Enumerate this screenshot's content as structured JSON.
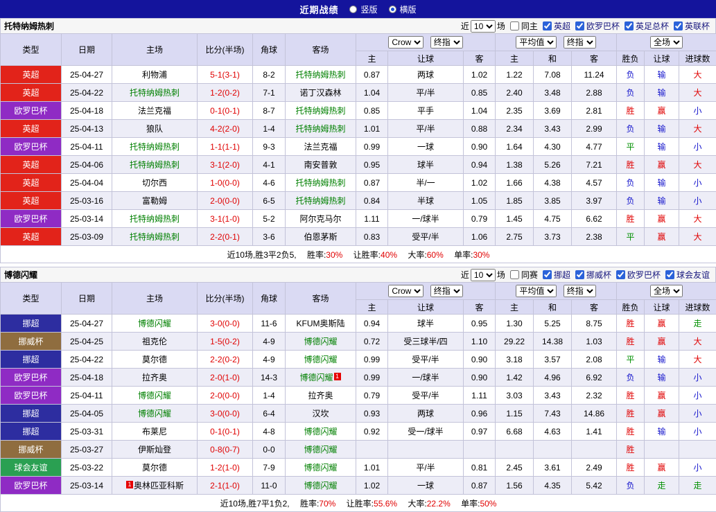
{
  "topbar": {
    "title": "近期战绩",
    "options": [
      {
        "label": "竖版",
        "selected": false
      },
      {
        "label": "横版",
        "selected": true
      }
    ]
  },
  "colors": {
    "topbar_bg": "#14149c",
    "header_bg": "#dadaf3",
    "alt_row_bg": "#ededf7",
    "focus_team_green": "#008000",
    "score_red": "#e00000",
    "result_red": "#e00000",
    "result_blue": "#1515cc",
    "result_green": "#009000",
    "league_colors": {
      "英超": "#e2231a",
      "欧罗巴杯": "#8f2bc4",
      "挪超": "#2d2da0",
      "挪威杯": "#8f6d3f",
      "球会友谊": "#2aa052"
    }
  },
  "sections": [
    {
      "team": "托特纳姆热刺",
      "filter": {
        "near": "近",
        "count": "10",
        "unit": "场",
        "same_label": "同主",
        "leagues": [
          "英超",
          "欧罗巴杯",
          "英足总杯",
          "英联杯"
        ]
      },
      "selects": {
        "book": "Crow",
        "fin1": "终指",
        "avg": "平均值",
        "fin2": "终指",
        "scope": "全场"
      },
      "columns": {
        "c1": "类型",
        "c2": "日期",
        "c3": "主场",
        "c4": "比分(半场)",
        "c5": "角球",
        "c6": "客场",
        "sub": [
          "主",
          "让球",
          "客",
          "主",
          "和",
          "客",
          "胜负",
          "让球",
          "进球数"
        ]
      },
      "rows": [
        {
          "lg": "英超",
          "date": "25-04-27",
          "home": "利物浦",
          "ht": 0,
          "hrc": "",
          "score": "5-1(3-1)",
          "cn": "8-2",
          "away": "托特纳姆热刺",
          "at": 1,
          "arc": "",
          "o1": "0.87",
          "line": "两球",
          "o2": "1.02",
          "e1": "1.22",
          "e2": "7.08",
          "e3": "11.24",
          "r1": "负",
          "r2": "输",
          "r3": "大"
        },
        {
          "lg": "英超",
          "date": "25-04-22",
          "home": "托特纳姆热刺",
          "ht": 1,
          "hrc": "",
          "score": "1-2(0-2)",
          "cn": "7-1",
          "away": "诺丁汉森林",
          "at": 0,
          "arc": "",
          "o1": "1.04",
          "line": "平/半",
          "o2": "0.85",
          "e1": "2.40",
          "e2": "3.48",
          "e3": "2.88",
          "r1": "负",
          "r2": "输",
          "r3": "大"
        },
        {
          "lg": "欧罗巴杯",
          "date": "25-04-18",
          "home": "法兰克福",
          "ht": 0,
          "hrc": "",
          "score": "0-1(0-1)",
          "cn": "8-7",
          "away": "托特纳姆热刺",
          "at": 1,
          "arc": "",
          "o1": "0.85",
          "line": "平手",
          "o2": "1.04",
          "e1": "2.35",
          "e2": "3.69",
          "e3": "2.81",
          "r1": "胜",
          "r2": "赢",
          "r3": "小"
        },
        {
          "lg": "英超",
          "date": "25-04-13",
          "home": "狼队",
          "ht": 0,
          "hrc": "",
          "score": "4-2(2-0)",
          "cn": "1-4",
          "away": "托特纳姆热刺",
          "at": 1,
          "arc": "",
          "o1": "1.01",
          "line": "平/半",
          "o2": "0.88",
          "e1": "2.34",
          "e2": "3.43",
          "e3": "2.99",
          "r1": "负",
          "r2": "输",
          "r3": "大"
        },
        {
          "lg": "欧罗巴杯",
          "date": "25-04-11",
          "home": "托特纳姆热刺",
          "ht": 1,
          "hrc": "",
          "score": "1-1(1-1)",
          "cn": "9-3",
          "away": "法兰克福",
          "at": 0,
          "arc": "",
          "o1": "0.99",
          "line": "一球",
          "o2": "0.90",
          "e1": "1.64",
          "e2": "4.30",
          "e3": "4.77",
          "r1": "平",
          "r2": "输",
          "r3": "小"
        },
        {
          "lg": "英超",
          "date": "25-04-06",
          "home": "托特纳姆热刺",
          "ht": 1,
          "hrc": "",
          "score": "3-1(2-0)",
          "cn": "4-1",
          "away": "南安普敦",
          "at": 0,
          "arc": "",
          "o1": "0.95",
          "line": "球半",
          "o2": "0.94",
          "e1": "1.38",
          "e2": "5.26",
          "e3": "7.21",
          "r1": "胜",
          "r2": "赢",
          "r3": "大"
        },
        {
          "lg": "英超",
          "date": "25-04-04",
          "home": "切尔西",
          "ht": 0,
          "hrc": "",
          "score": "1-0(0-0)",
          "cn": "4-6",
          "away": "托特纳姆热刺",
          "at": 1,
          "arc": "",
          "o1": "0.87",
          "line": "半/一",
          "o2": "1.02",
          "e1": "1.66",
          "e2": "4.38",
          "e3": "4.57",
          "r1": "负",
          "r2": "输",
          "r3": "小"
        },
        {
          "lg": "英超",
          "date": "25-03-16",
          "home": "富勒姆",
          "ht": 0,
          "hrc": "",
          "score": "2-0(0-0)",
          "cn": "6-5",
          "away": "托特纳姆热刺",
          "at": 1,
          "arc": "",
          "o1": "0.84",
          "line": "半球",
          "o2": "1.05",
          "e1": "1.85",
          "e2": "3.85",
          "e3": "3.97",
          "r1": "负",
          "r2": "输",
          "r3": "小"
        },
        {
          "lg": "欧罗巴杯",
          "date": "25-03-14",
          "home": "托特纳姆热刺",
          "ht": 1,
          "hrc": "",
          "score": "3-1(1-0)",
          "cn": "5-2",
          "away": "阿尔克马尔",
          "at": 0,
          "arc": "",
          "o1": "1.11",
          "line": "一/球半",
          "o2": "0.79",
          "e1": "1.45",
          "e2": "4.75",
          "e3": "6.62",
          "r1": "胜",
          "r2": "赢",
          "r3": "大"
        },
        {
          "lg": "英超",
          "date": "25-03-09",
          "home": "托特纳姆热刺",
          "ht": 1,
          "hrc": "",
          "score": "2-2(0-1)",
          "cn": "3-6",
          "away": "伯恩茅斯",
          "at": 0,
          "arc": "",
          "o1": "0.83",
          "line": "受平/半",
          "o2": "1.06",
          "e1": "2.75",
          "e2": "3.73",
          "e3": "2.38",
          "r1": "平",
          "r2": "赢",
          "r3": "大"
        }
      ],
      "summary": {
        "prefix": "近10场,胜3平2负5,",
        "parts": [
          {
            "label": "胜率:",
            "value": "30%"
          },
          {
            "label": "让胜率:",
            "value": "40%"
          },
          {
            "label": "大率:",
            "value": "60%"
          },
          {
            "label": "单率:",
            "value": "30%"
          }
        ]
      }
    },
    {
      "team": "博德闪耀",
      "filter": {
        "near": "近",
        "count": "10",
        "unit": "场",
        "same_label": "同赛",
        "leagues": [
          "挪超",
          "挪威杯",
          "欧罗巴杯",
          "球会友谊"
        ]
      },
      "selects": {
        "book": "Crow",
        "fin1": "终指",
        "avg": "平均值",
        "fin2": "终指",
        "scope": "全场"
      },
      "columns": {
        "c1": "类型",
        "c2": "日期",
        "c3": "主场",
        "c4": "比分(半场)",
        "c5": "角球",
        "c6": "客场",
        "sub": [
          "主",
          "让球",
          "客",
          "主",
          "和",
          "客",
          "胜负",
          "让球",
          "进球数"
        ]
      },
      "rows": [
        {
          "lg": "挪超",
          "date": "25-04-27",
          "home": "博德闪耀",
          "ht": 1,
          "hrc": "",
          "score": "3-0(0-0)",
          "cn": "11-6",
          "away": "KFUM奥斯陆",
          "at": 0,
          "arc": "",
          "o1": "0.94",
          "line": "球半",
          "o2": "0.95",
          "e1": "1.30",
          "e2": "5.25",
          "e3": "8.75",
          "r1": "胜",
          "r2": "赢",
          "r3": "走"
        },
        {
          "lg": "挪威杯",
          "date": "25-04-25",
          "home": "祖克伦",
          "ht": 0,
          "hrc": "",
          "score": "1-5(0-2)",
          "cn": "4-9",
          "away": "博德闪耀",
          "at": 1,
          "arc": "",
          "o1": "0.72",
          "line": "受三球半/四",
          "o2": "1.10",
          "e1": "29.22",
          "e2": "14.38",
          "e3": "1.03",
          "r1": "胜",
          "r2": "赢",
          "r3": "大"
        },
        {
          "lg": "挪超",
          "date": "25-04-22",
          "home": "莫尔德",
          "ht": 0,
          "hrc": "",
          "score": "2-2(0-2)",
          "cn": "4-9",
          "away": "博德闪耀",
          "at": 1,
          "arc": "",
          "o1": "0.99",
          "line": "受平/半",
          "o2": "0.90",
          "e1": "3.18",
          "e2": "3.57",
          "e3": "2.08",
          "r1": "平",
          "r2": "输",
          "r3": "大"
        },
        {
          "lg": "欧罗巴杯",
          "date": "25-04-18",
          "home": "拉齐奥",
          "ht": 0,
          "hrc": "",
          "score": "2-0(1-0)",
          "cn": "14-3",
          "away": "博德闪耀",
          "at": 1,
          "arc": "1",
          "o1": "0.99",
          "line": "一/球半",
          "o2": "0.90",
          "e1": "1.42",
          "e2": "4.96",
          "e3": "6.92",
          "r1": "负",
          "r2": "输",
          "r3": "小"
        },
        {
          "lg": "欧罗巴杯",
          "date": "25-04-11",
          "home": "博德闪耀",
          "ht": 1,
          "hrc": "",
          "score": "2-0(0-0)",
          "cn": "1-4",
          "away": "拉齐奥",
          "at": 0,
          "arc": "",
          "o1": "0.79",
          "line": "受平/半",
          "o2": "1.11",
          "e1": "3.03",
          "e2": "3.43",
          "e3": "2.32",
          "r1": "胜",
          "r2": "赢",
          "r3": "小"
        },
        {
          "lg": "挪超",
          "date": "25-04-05",
          "home": "博德闪耀",
          "ht": 1,
          "hrc": "",
          "score": "3-0(0-0)",
          "cn": "6-4",
          "away": "汉坎",
          "at": 0,
          "arc": "",
          "o1": "0.93",
          "line": "两球",
          "o2": "0.96",
          "e1": "1.15",
          "e2": "7.43",
          "e3": "14.86",
          "r1": "胜",
          "r2": "赢",
          "r3": "小"
        },
        {
          "lg": "挪超",
          "date": "25-03-31",
          "home": "布莱尼",
          "ht": 0,
          "hrc": "",
          "score": "0-1(0-1)",
          "cn": "4-8",
          "away": "博德闪耀",
          "at": 1,
          "arc": "",
          "o1": "0.92",
          "line": "受一/球半",
          "o2": "0.97",
          "e1": "6.68",
          "e2": "4.63",
          "e3": "1.41",
          "r1": "胜",
          "r2": "输",
          "r3": "小"
        },
        {
          "lg": "挪威杯",
          "date": "25-03-27",
          "home": "伊斯灿登",
          "ht": 0,
          "hrc": "",
          "score": "0-8(0-7)",
          "cn": "0-0",
          "away": "博德闪耀",
          "at": 1,
          "arc": "",
          "o1": "",
          "line": "",
          "o2": "",
          "e1": "",
          "e2": "",
          "e3": "",
          "r1": "胜",
          "r2": "",
          "r3": ""
        },
        {
          "lg": "球会友谊",
          "date": "25-03-22",
          "home": "莫尔德",
          "ht": 0,
          "hrc": "",
          "score": "1-2(1-0)",
          "cn": "7-9",
          "away": "博德闪耀",
          "at": 1,
          "arc": "",
          "o1": "1.01",
          "line": "平/半",
          "o2": "0.81",
          "e1": "2.45",
          "e2": "3.61",
          "e3": "2.49",
          "r1": "胜",
          "r2": "赢",
          "r3": "小"
        },
        {
          "lg": "欧罗巴杯",
          "date": "25-03-14",
          "home": "奥林匹亚科斯",
          "ht": 0,
          "hrc": "1",
          "score": "2-1(1-0)",
          "cn": "11-0",
          "away": "博德闪耀",
          "at": 1,
          "arc": "",
          "o1": "1.02",
          "line": "一球",
          "o2": "0.87",
          "e1": "1.56",
          "e2": "4.35",
          "e3": "5.42",
          "r1": "负",
          "r2": "走",
          "r3": "走"
        }
      ],
      "summary": {
        "prefix": "近10场,胜7平1负2,",
        "parts": [
          {
            "label": "胜率:",
            "value": "70%"
          },
          {
            "label": "让胜率:",
            "value": "55.6%"
          },
          {
            "label": "大率:",
            "value": "22.2%"
          },
          {
            "label": "单率:",
            "value": "50%"
          }
        ]
      }
    }
  ]
}
